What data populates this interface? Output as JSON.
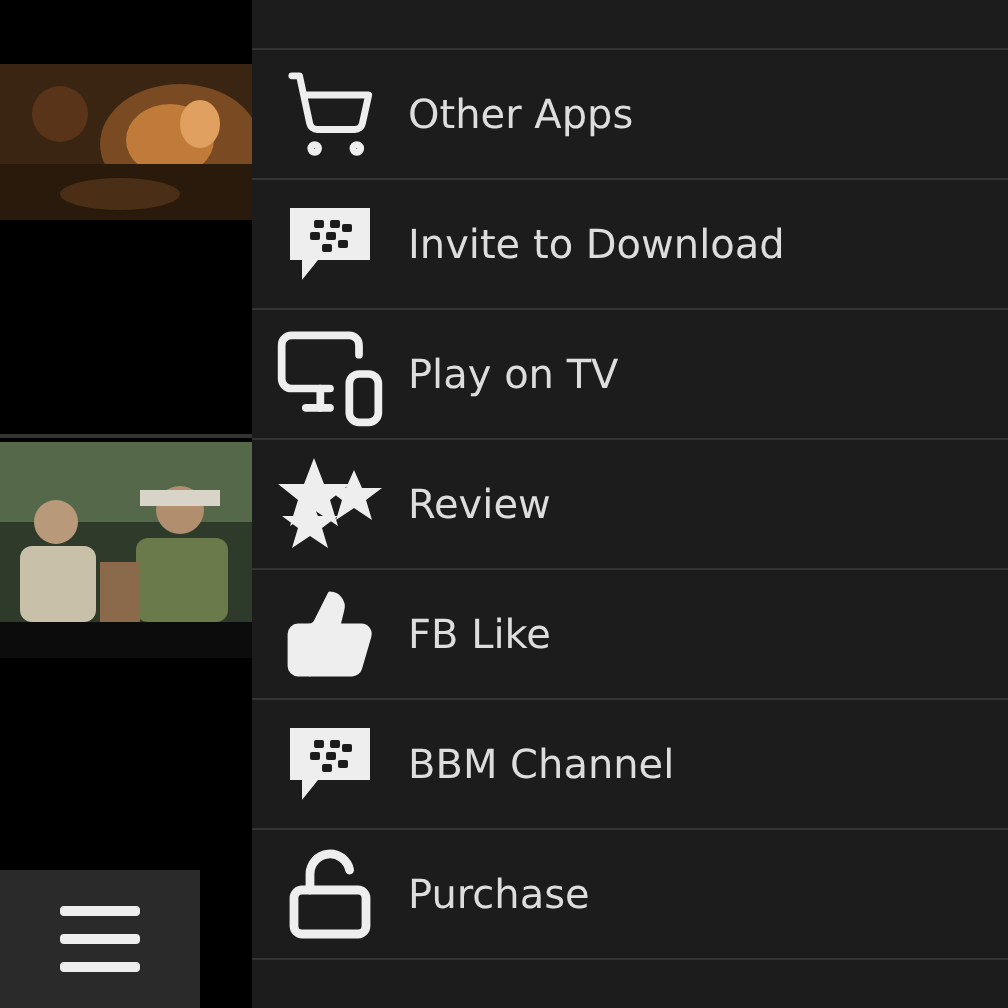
{
  "menu": {
    "items": [
      {
        "label": "Other Apps"
      },
      {
        "label": "Invite to Download"
      },
      {
        "label": "Play on TV"
      },
      {
        "label": "Review"
      },
      {
        "label": "FB Like"
      },
      {
        "label": "BBM Channel"
      },
      {
        "label": "Purchase"
      }
    ]
  }
}
